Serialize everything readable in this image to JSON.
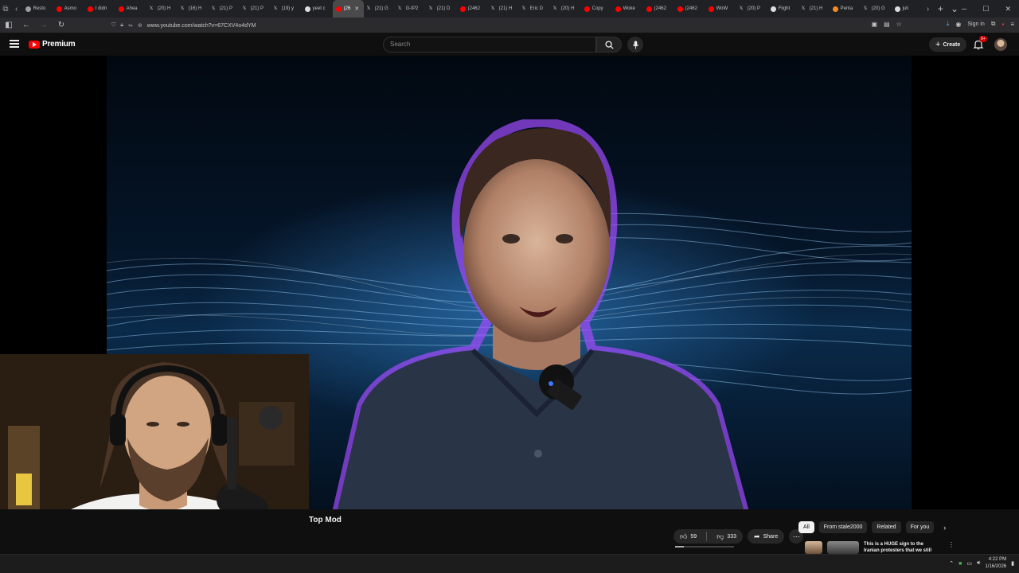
{
  "browser": {
    "tabs": [
      {
        "label": "Resto",
        "icon": "clock-icon",
        "color": "#9aa0a6"
      },
      {
        "label": "Asmo",
        "icon": "youtube-icon",
        "color": "#ff0000"
      },
      {
        "label": "I didn",
        "icon": "youtube-icon",
        "color": "#ff0000"
      },
      {
        "label": "Ahea",
        "icon": "youtube-icon",
        "color": "#ff0000"
      },
      {
        "label": "(20) H",
        "icon": "x-icon",
        "color": "#dddddd"
      },
      {
        "label": "(16) H",
        "icon": "x-icon",
        "color": "#dddddd"
      },
      {
        "label": "(21) P",
        "icon": "x-icon",
        "color": "#dddddd"
      },
      {
        "label": "(21) P",
        "icon": "x-icon",
        "color": "#dddddd"
      },
      {
        "label": "(19) y",
        "icon": "x-icon",
        "color": "#dddddd"
      },
      {
        "label": "yeet c",
        "icon": "github-icon",
        "color": "#dddddd"
      },
      {
        "label": "(26",
        "icon": "youtube-icon",
        "color": "#ff0000",
        "active": true
      },
      {
        "label": "(21) G",
        "icon": "x-icon",
        "color": "#dddddd"
      },
      {
        "label": "G-tP2",
        "icon": "x-icon",
        "color": "#dddddd"
      },
      {
        "label": "(21) D",
        "icon": "x-icon",
        "color": "#dddddd"
      },
      {
        "label": "(2462",
        "icon": "youtube-icon",
        "color": "#ff0000"
      },
      {
        "label": "(21) H",
        "icon": "x-icon",
        "color": "#dddddd"
      },
      {
        "label": "Eric D",
        "icon": "x-icon",
        "color": "#dddddd"
      },
      {
        "label": "(20) H",
        "icon": "x-icon",
        "color": "#dddddd"
      },
      {
        "label": "Copy",
        "icon": "youtube-icon",
        "color": "#ff0000"
      },
      {
        "label": "Woke",
        "icon": "youtube-icon",
        "color": "#ff0000"
      },
      {
        "label": "(2462",
        "icon": "youtube-icon",
        "color": "#ff0000"
      },
      {
        "label": "(2462",
        "icon": "youtube-icon",
        "color": "#ff0000"
      },
      {
        "label": "WoW",
        "icon": "youtube-icon",
        "color": "#ff0000"
      },
      {
        "label": "(20) P",
        "icon": "x-icon",
        "color": "#dddddd"
      },
      {
        "label": "Flight",
        "icon": "github-icon",
        "color": "#dddddd"
      },
      {
        "label": "(21) H",
        "icon": "x-icon",
        "color": "#dddddd"
      },
      {
        "label": "Penta",
        "icon": "shield-icon",
        "color": "#f28b22"
      },
      {
        "label": "(20) G",
        "icon": "x-icon",
        "color": "#dddddd"
      },
      {
        "label": "juli",
        "icon": "globe-icon",
        "color": "#dddddd"
      }
    ],
    "url": "www.youtube.com/watch?v=67CXV4o4dYM",
    "sign_in": "Sign in"
  },
  "youtube": {
    "brand": "Premium",
    "search_placeholder": "Search",
    "create_label": "Create",
    "notifications_badge": "9+",
    "video": {
      "title": "Top Mod",
      "likes": "59",
      "dislikes": "333",
      "like_fraction": 0.15,
      "share_label": "Share"
    },
    "chips": [
      "All",
      "From stale2000",
      "Related",
      "For you"
    ],
    "recommendation": {
      "title": "This is a HUGE sign to the",
      "subtitle": "Iranian protesters that we still"
    }
  },
  "taskbar": {
    "time": "4:22 PM",
    "date": "1/16/2026"
  }
}
